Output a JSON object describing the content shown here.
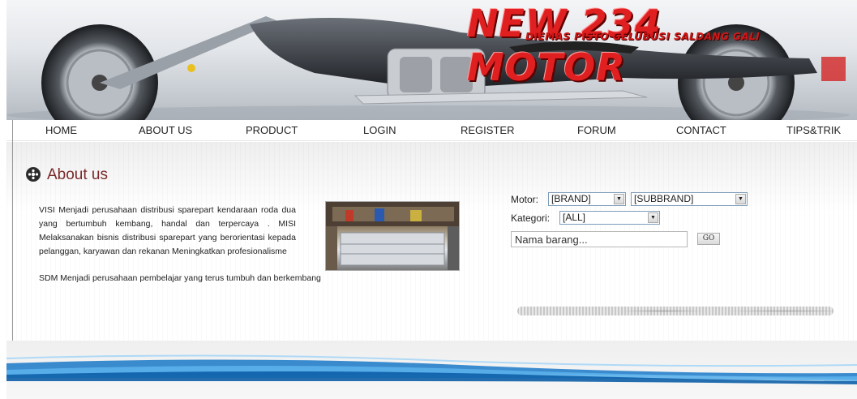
{
  "header": {
    "brand_title": "NEW 234 MOTOR",
    "brand_subtitle": "DIEMAS PISTO GELUBUSI SALDANG GALI"
  },
  "nav": {
    "items": [
      {
        "label": "HOME"
      },
      {
        "label": "ABOUT US"
      },
      {
        "label": "PRODUCT"
      },
      {
        "label": "LOGIN"
      },
      {
        "label": "REGISTER"
      },
      {
        "label": "FORUM"
      },
      {
        "label": "CONTACT"
      },
      {
        "label": "TIPS&TRIK"
      }
    ]
  },
  "about": {
    "title": "About us",
    "paragraph": "VISI Menjadi perusahaan distribusi sparepart kendaraan roda dua yang bertumbuh kembang, handal dan terpercaya . MISI Melaksanakan bisnis distribusi sparepart yang berorientasi kepada pelanggan, karyawan dan rekanan Meningkatkan profesionalisme",
    "last_line": "SDM Menjadi perusahaan pembelajar yang terus tumbuh dan berkembang"
  },
  "search": {
    "motor_label": "Motor:",
    "brand_select": "[BRAND]",
    "subbrand_select": "[SUBBRAND]",
    "kategori_label": "Kategori:",
    "kategori_select": "[ALL]",
    "name_input_value": "Nama barang...",
    "go_label": "GO"
  },
  "colors": {
    "title_red": "#e02020",
    "section_title": "#7a2a2a",
    "footer_wave": "#1a78c8"
  }
}
